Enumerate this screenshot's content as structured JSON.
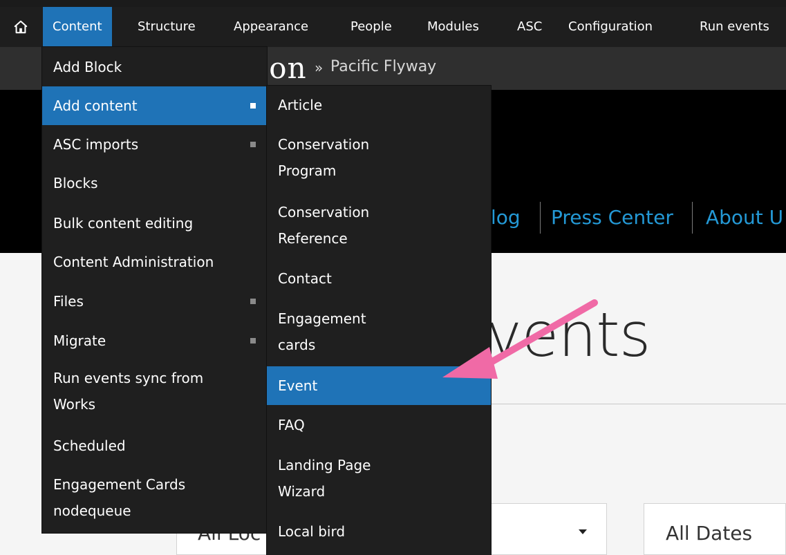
{
  "admin_menu": {
    "items": [
      {
        "label": "Content"
      },
      {
        "label": "Structure"
      },
      {
        "label": "Appearance"
      },
      {
        "label": "People"
      },
      {
        "label": "Modules"
      },
      {
        "label": "ASC"
      },
      {
        "label": "Configuration"
      },
      {
        "label": "Run events"
      }
    ]
  },
  "breadcrumb": {
    "logo": "oon",
    "separator": "»",
    "current": "Pacific Flyway"
  },
  "site_nav": {
    "items": [
      "log",
      "Press Center",
      "About U"
    ]
  },
  "page": {
    "title": "events"
  },
  "filters": {
    "location_partial": "All Loc",
    "dates": "All Dates"
  },
  "content_menu": {
    "items": [
      {
        "label": "Add Block"
      },
      {
        "label": "Add content"
      },
      {
        "label": "ASC imports"
      },
      {
        "label": "Blocks"
      },
      {
        "label": "Bulk content editing"
      },
      {
        "label": "Content Administration"
      },
      {
        "label": "Files"
      },
      {
        "label": "Migrate"
      },
      {
        "line1": "Run events sync from",
        "line2": "Works"
      },
      {
        "label": "Scheduled"
      },
      {
        "line1": "Engagement Cards",
        "line2": "nodequeue"
      }
    ]
  },
  "add_content_menu": {
    "items": [
      {
        "label": "Article"
      },
      {
        "line1": "Conservation",
        "line2": "Program"
      },
      {
        "line1": "Conservation",
        "line2": "Reference"
      },
      {
        "label": "Contact"
      },
      {
        "line1": "Engagement",
        "line2": "cards"
      },
      {
        "label": "Event"
      },
      {
        "label": "FAQ"
      },
      {
        "line1": "Landing Page",
        "line2": "Wizard"
      },
      {
        "label": "Local bird"
      }
    ]
  },
  "colors": {
    "active_blue": "#1f73b7",
    "menu_bg": "#1f1f1f",
    "annotation_pink": "#f06aa6"
  },
  "icons": {
    "home": "home-icon"
  }
}
